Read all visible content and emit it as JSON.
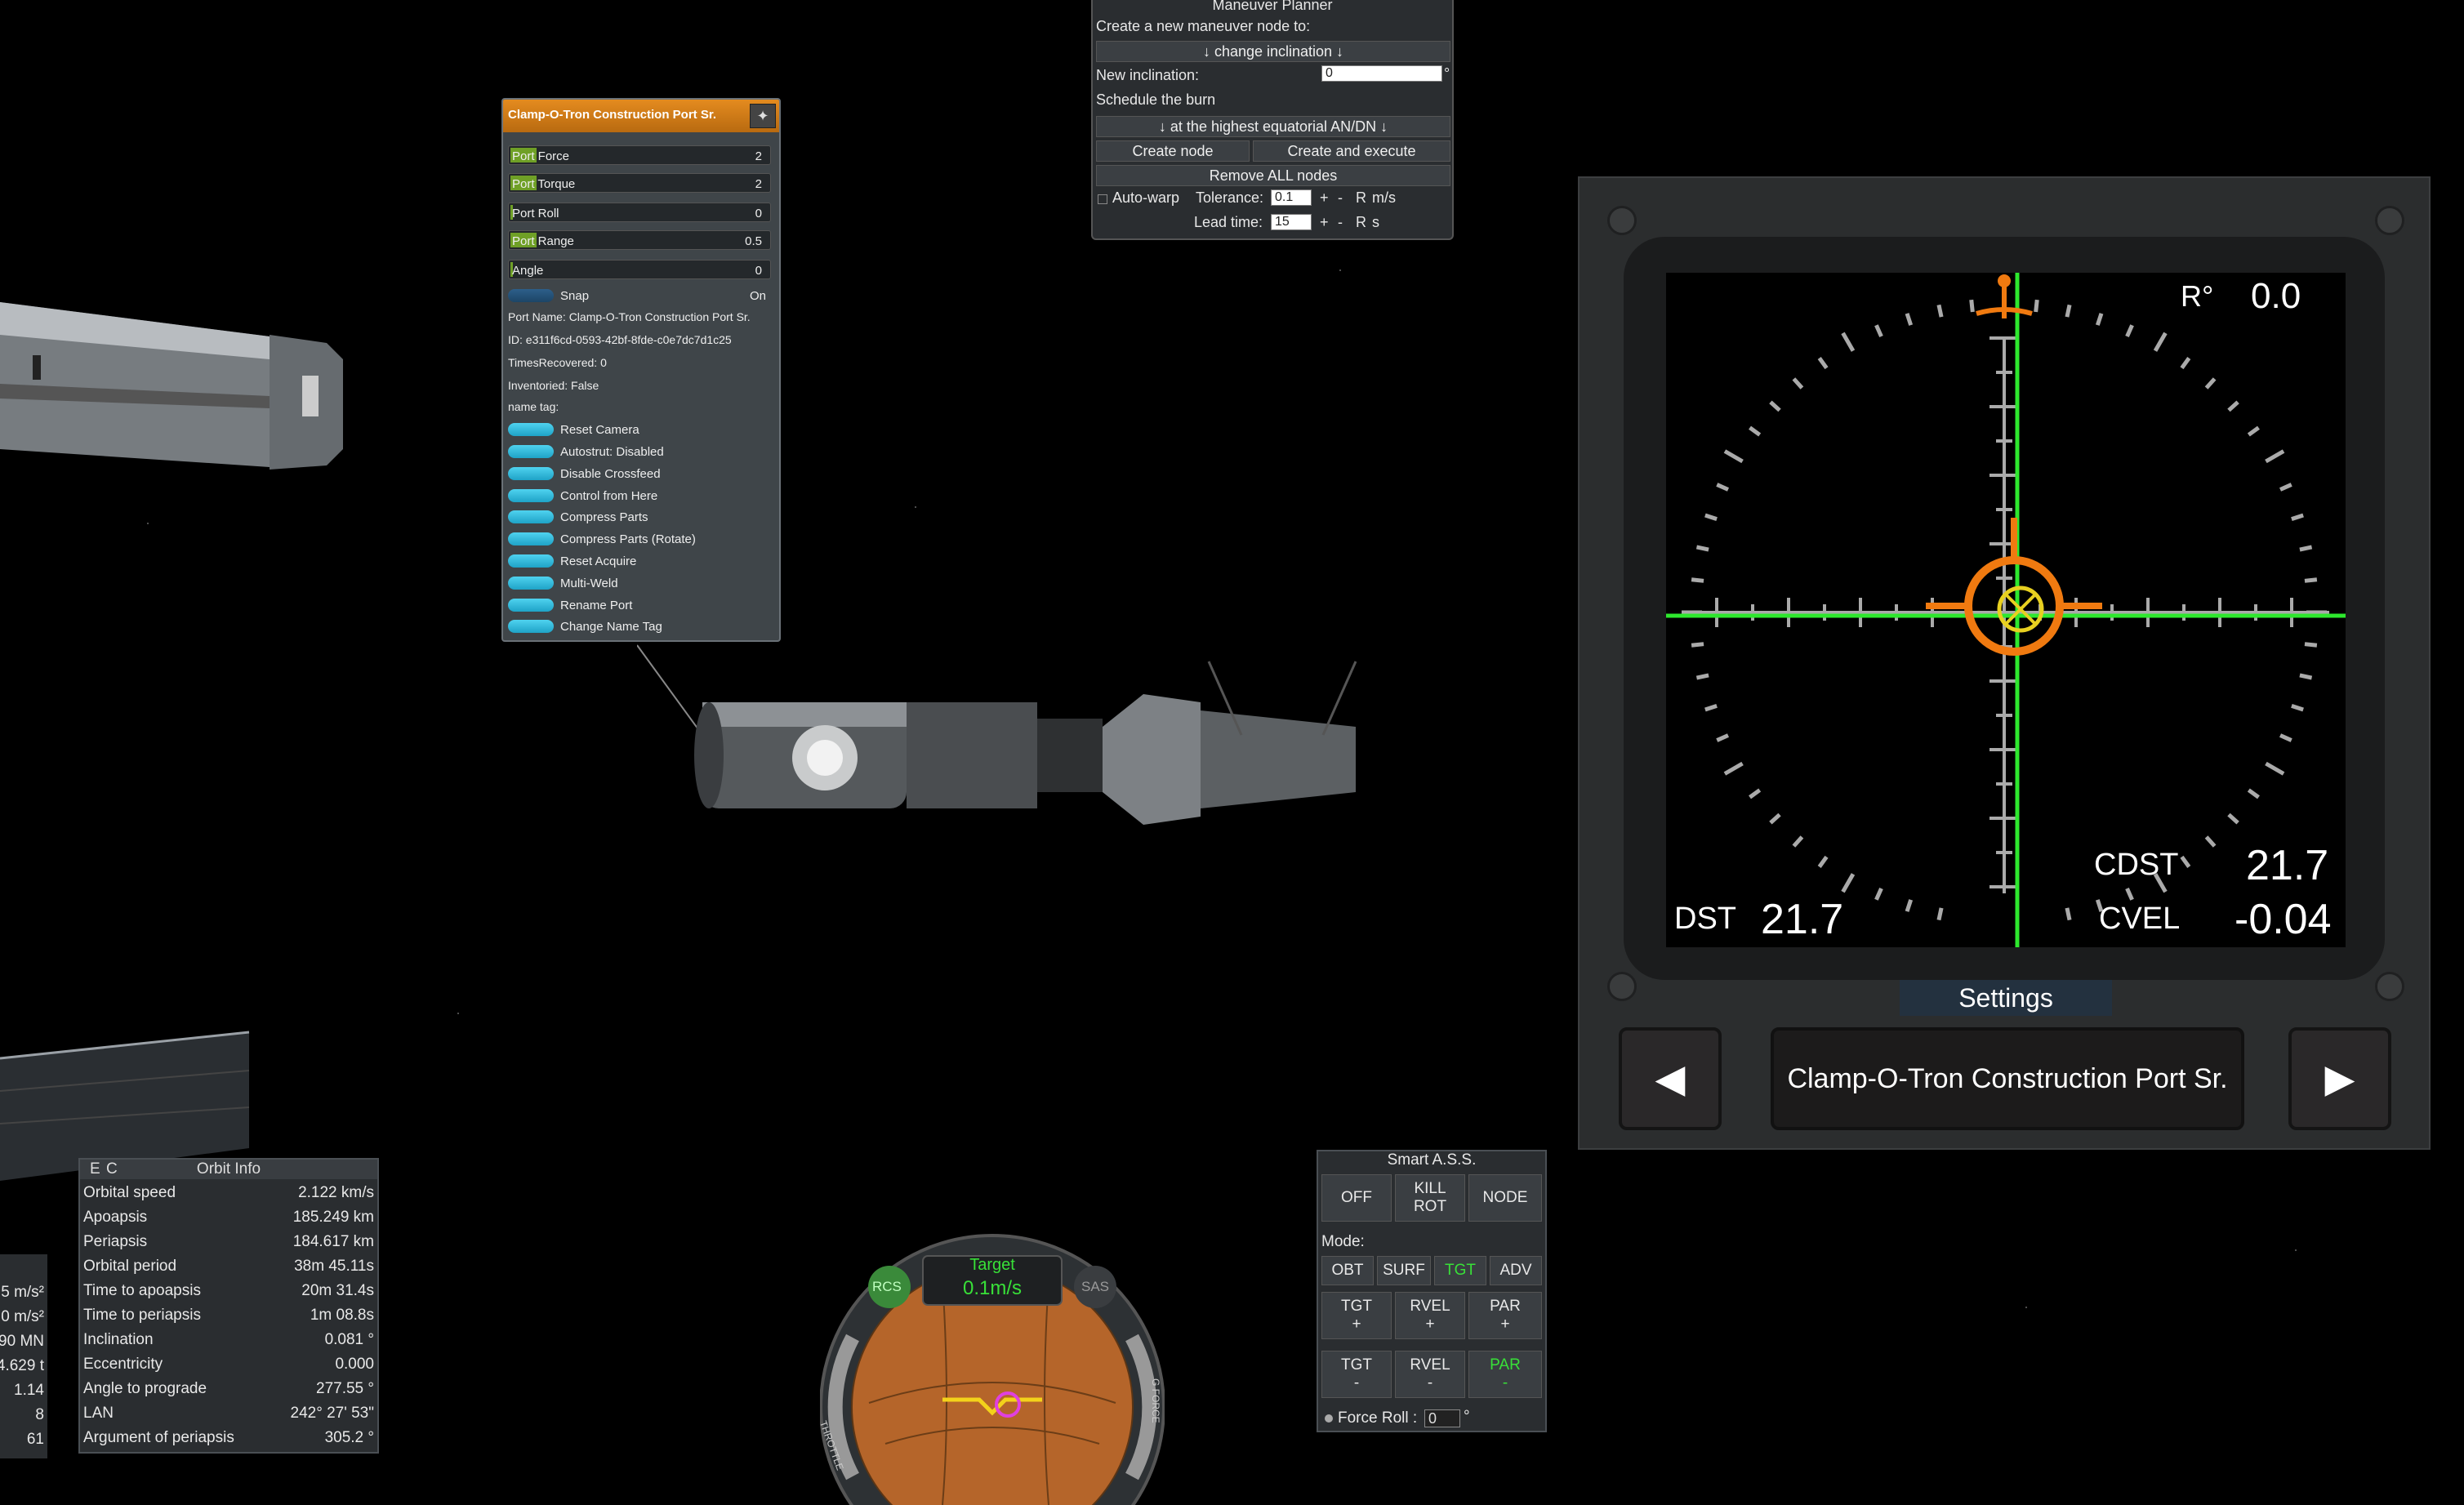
{
  "part_window": {
    "title": "Clamp-O-Tron Construction Port Sr.",
    "sliders": [
      {
        "label": "Port Force",
        "value": "2",
        "level": 0.1
      },
      {
        "label": "Port Torque",
        "value": "2",
        "level": 0.1
      },
      {
        "label": "Port Roll",
        "value": "0",
        "level": 0
      },
      {
        "label": "Port Range",
        "value": "0.5",
        "level": 0.1
      },
      {
        "label": "Angle",
        "value": "0",
        "level": 0
      }
    ],
    "snap_label": "Snap",
    "snap_value": "On",
    "info": [
      "Port Name: Clamp-O-Tron Construction Port Sr.",
      "ID: e311f6cd-0593-42bf-8fde-c0e7dc7d1c25",
      "TimesRecovered: 0",
      "Inventoried: False",
      "name tag:"
    ],
    "buttons": [
      "Reset Camera",
      "Autostrut: Disabled",
      "Disable Crossfeed",
      "Control from Here",
      "Compress Parts",
      "Compress Parts (Rotate)",
      "Reset Acquire",
      "Multi-Weld",
      "Rename Port",
      "Change Name Tag"
    ]
  },
  "maneuver_planner": {
    "title": "Maneuver Planner",
    "create_label": "Create a new maneuver node to:",
    "operation": "↓ change inclination ↓",
    "new_inclination_label": "New inclination:",
    "new_inclination_value": "0",
    "degree": "°",
    "schedule_label": "Schedule the burn",
    "schedule_value": "↓ at the highest equatorial AN/DN ↓",
    "create_node": "Create node",
    "create_execute": "Create and execute",
    "remove_all": "Remove ALL nodes",
    "autowarp": "Auto-warp",
    "tolerance_label": "Tolerance:",
    "tolerance_value": "0.1",
    "tolerance_unit": "m/s",
    "lead_label": "Lead time:",
    "lead_value": "15",
    "lead_unit": "s",
    "plus": "+",
    "minus": "-",
    "r": "R"
  },
  "dpai": {
    "roll_label": "R°",
    "roll_value": "0.0",
    "dst_label": "DST",
    "dst_value": "21.7",
    "cdst_label": "CDST",
    "cdst_value": "21.7",
    "cvel_label": "CVEL",
    "cvel_value": "-0.04",
    "settings": "Settings",
    "port_name": "Clamp-O-Tron Construction Port Sr.",
    "prev": "◀",
    "next": "▶"
  },
  "orbit_info": {
    "title": "Orbit Info",
    "e": "E",
    "c": "C",
    "rows": [
      {
        "k": "Orbital speed",
        "v": "2.122 km/s"
      },
      {
        "k": "Apoapsis",
        "v": "185.249 km"
      },
      {
        "k": "Periapsis",
        "v": "184.617 km"
      },
      {
        "k": "Orbital period",
        "v": "38m 45.11s"
      },
      {
        "k": "Time to apoapsis",
        "v": "20m 31.4s"
      },
      {
        "k": "Time to periapsis",
        "v": "1m 08.8s"
      },
      {
        "k": "Inclination",
        "v": "0.081 °"
      },
      {
        "k": "Eccentricity",
        "v": "0.000"
      },
      {
        "k": "Angle to prograde",
        "v": "277.55 °"
      },
      {
        "k": "LAN",
        "v": "242° 27' 53\""
      },
      {
        "k": "Argument of periapsis",
        "v": "305.2 °"
      }
    ]
  },
  "left_values": [
    "5 m/s²",
    "0 m/s²",
    "90 MN",
    "4.629 t",
    "1.14",
    "8",
    "61"
  ],
  "smart_ass": {
    "title": "Smart A.S.S.",
    "off": "OFF",
    "kill_rot": "KILL\nROT",
    "node": "NODE",
    "mode_label": "Mode:",
    "modes": [
      "OBT",
      "SURF",
      "TGT",
      "ADV"
    ],
    "row3": [
      "TGT\n+",
      "RVEL\n+",
      "PAR\n+"
    ],
    "row4": [
      "TGT\n-",
      "RVEL\n-",
      "PAR\n-"
    ],
    "force_roll_label": "Force Roll :",
    "force_roll_value": "0",
    "degree": "°",
    "active_color": "#38e038"
  },
  "navball": {
    "mode": "Target",
    "speed": "0.1m/s",
    "rcs": "RCS",
    "sas": "SAS",
    "throttle": "THROTTLE",
    "gforce": "G FORCE"
  },
  "colors": {
    "paw_title": "#e48b1f",
    "dpai_crosshair": "#2ee82e",
    "dpai_target": "#f07a10",
    "active_green": "#38e038"
  }
}
